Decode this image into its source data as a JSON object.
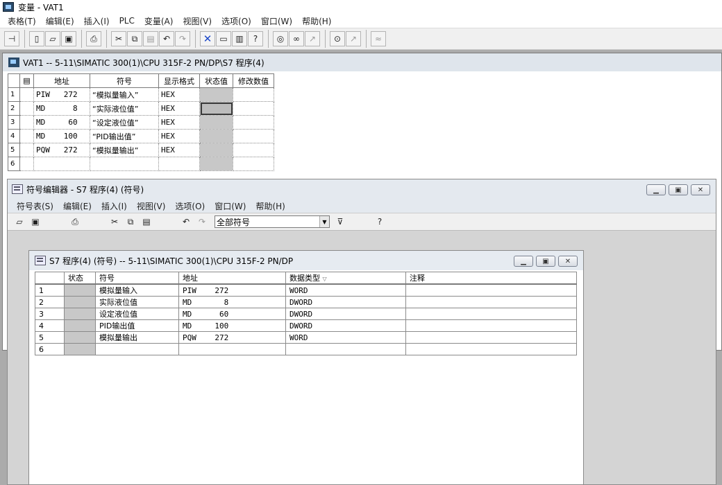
{
  "app": {
    "title": "变量 - VAT1"
  },
  "menubar": [
    "表格(T)",
    "编辑(E)",
    "插入(I)",
    "PLC",
    "变量(A)",
    "视图(V)",
    "选项(O)",
    "窗口(W)",
    "帮助(H)"
  ],
  "vat": {
    "title": "VAT1 -- 5-11\\SIMATIC 300(1)\\CPU 315F-2 PN/DP\\S7 程序(4)",
    "headers": [
      "地址",
      "符号",
      "显示格式",
      "状态值",
      "修改数值"
    ],
    "rows": [
      {
        "n": "1",
        "addr": "PIW   272",
        "sym": "“模拟量输入”",
        "fmt": "HEX"
      },
      {
        "n": "2",
        "addr": "MD      8",
        "sym": "“实际液位值”",
        "fmt": "HEX"
      },
      {
        "n": "3",
        "addr": "MD     60",
        "sym": "“设定液位值”",
        "fmt": "HEX"
      },
      {
        "n": "4",
        "addr": "MD    100",
        "sym": "“PID输出值”",
        "fmt": "HEX"
      },
      {
        "n": "5",
        "addr": "PQW   272",
        "sym": "“模拟量输出”",
        "fmt": "HEX"
      },
      {
        "n": "6",
        "addr": "",
        "sym": "",
        "fmt": ""
      }
    ]
  },
  "symwin": {
    "title": "符号编辑器 - S7 程序(4) (符号)",
    "menu": [
      "符号表(S)",
      "编辑(E)",
      "插入(I)",
      "视图(V)",
      "选项(O)",
      "窗口(W)",
      "帮助(H)"
    ],
    "filter": "全部符号"
  },
  "doc": {
    "title": "S7 程序(4) (符号) -- 5-11\\SIMATIC 300(1)\\CPU 315F-2 PN/DP",
    "headers": [
      "状态",
      "符号",
      "地址",
      "数据类型",
      "注释"
    ],
    "rows": [
      {
        "n": "1",
        "sym": "模拟量输入",
        "addr": "PIW    272",
        "type": "WORD"
      },
      {
        "n": "2",
        "sym": "实际液位值",
        "addr": "MD       8",
        "type": "DWORD"
      },
      {
        "n": "3",
        "sym": "设定液位值",
        "addr": "MD      60",
        "type": "DWORD"
      },
      {
        "n": "4",
        "sym": "PID输出值",
        "addr": "MD     100",
        "type": "DWORD"
      },
      {
        "n": "5",
        "sym": "模拟量输出",
        "addr": "PQW    272",
        "type": "WORD"
      },
      {
        "n": "6",
        "sym": "",
        "addr": "",
        "type": ""
      }
    ]
  }
}
